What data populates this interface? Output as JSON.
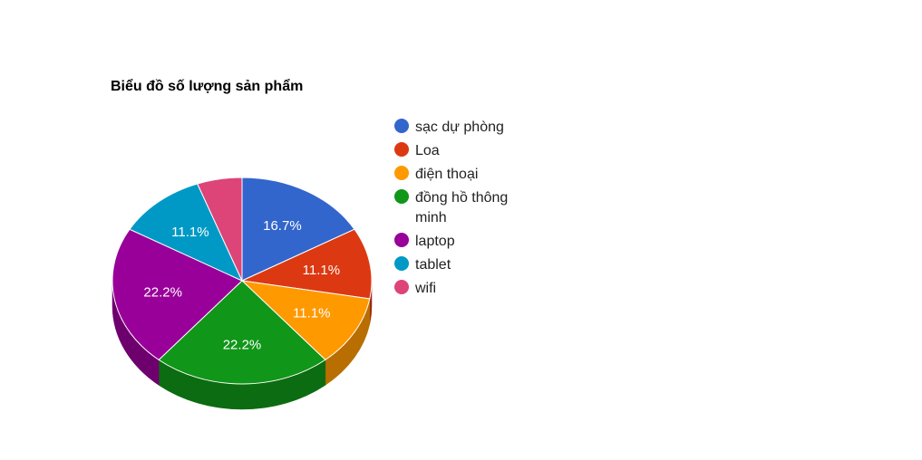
{
  "chart_data": {
    "type": "pie",
    "title": "Biểu đồ số lượng sản phẩm",
    "is_3d": true,
    "legend_position": "right",
    "slices": [
      {
        "name": "sạc dự phòng",
        "percent": 16.7,
        "label": "16.7%",
        "color": "#3366cc"
      },
      {
        "name": "Loa",
        "percent": 11.1,
        "label": "11.1%",
        "color": "#dc3912"
      },
      {
        "name": "điện thoại",
        "percent": 11.1,
        "label": "11.1%",
        "color": "#ff9900"
      },
      {
        "name": "đồng hồ thông minh",
        "percent": 22.2,
        "label": "22.2%",
        "color": "#109618",
        "legend_lines": [
          "đồng hồ thông",
          "minh"
        ]
      },
      {
        "name": "laptop",
        "percent": 22.2,
        "label": "22.2%",
        "color": "#990099"
      },
      {
        "name": "tablet",
        "percent": 11.1,
        "label": "11.1%",
        "color": "#0099c6"
      },
      {
        "name": "wifi",
        "percent": 5.6,
        "label": "",
        "color": "#dd4477"
      }
    ]
  }
}
